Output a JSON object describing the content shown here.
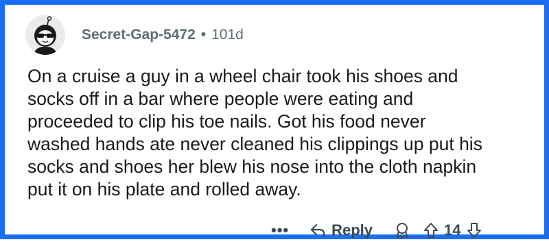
{
  "comment": {
    "username": "Secret-Gap-5472",
    "separator": "•",
    "age": "101d",
    "body": "On a cruise a guy in a wheel chair took his shoes and\nsocks off in a bar where people were eating and\nproceeded to clip his toe nails. Got his food never\nwashed hands ate never cleaned his clippings up put his\nsocks and shoes her blew his nose into the cloth napkin\nput it on his plate and rolled away."
  },
  "actions": {
    "more_label": "•••",
    "reply_label": "Reply",
    "vote_count": "14"
  },
  "icons": {
    "avatar": "avatar-icon",
    "reply": "reply-arrow-icon",
    "award": "award-icon",
    "upvote": "upvote-arrow-icon",
    "downvote": "downvote-arrow-icon"
  },
  "colors": {
    "border": "#1b6ef3",
    "meta_text": "#576f76",
    "body_text": "#1a1a1b"
  }
}
